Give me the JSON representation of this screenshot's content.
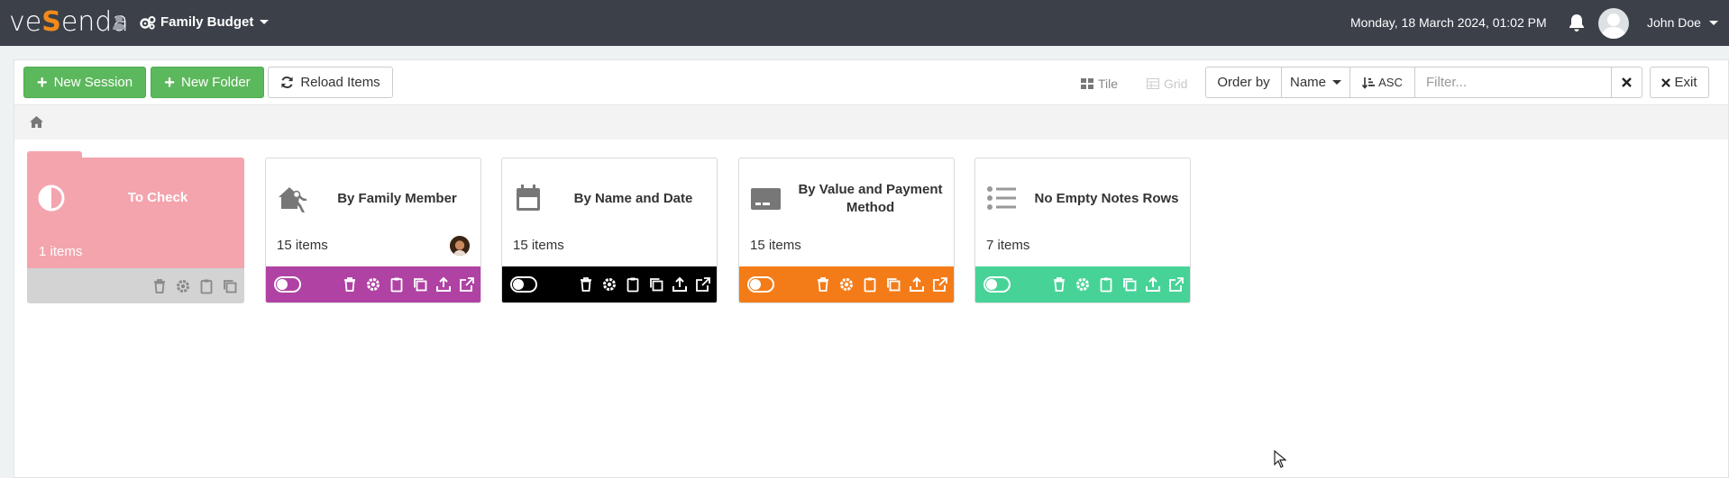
{
  "header": {
    "logo_text_a": "ve",
    "logo_text_s": "S",
    "logo_text_b": "enda",
    "workspace": "Family Budget",
    "datetime": "Monday, 18 March 2024, 01:02 PM",
    "user_name": "John Doe"
  },
  "toolbar": {
    "new_session": "New Session",
    "new_folder": "New Folder",
    "reload_items": "Reload Items",
    "tile": "Tile",
    "grid": "Grid",
    "order_by": "Order by",
    "order_field": "Name",
    "order_dir": "ASC",
    "filter_placeholder": "Filter...",
    "exit": "Exit"
  },
  "folder": {
    "title": "To Check",
    "count": "1 items",
    "color": "#f4a4ad",
    "footer_color": "#d3d3d3"
  },
  "cards": [
    {
      "title": "By Family Member",
      "count": "15 items",
      "footer_color": "#b042a4",
      "icon": "person-house-icon"
    },
    {
      "title": "By Name and Date",
      "count": "15 items",
      "footer_color": "#000000",
      "icon": "calendar-icon"
    },
    {
      "title": "By Value and Payment Method",
      "count": "15 items",
      "footer_color": "#f47c18",
      "icon": "credit-card-icon"
    },
    {
      "title": "No Empty Notes Rows",
      "count": "7 items",
      "footer_color": "#47d398",
      "icon": "list-icon"
    }
  ],
  "colors": {
    "topbar": "#3b4049",
    "accent": "#f28b1b",
    "green_button": "#5cb85c"
  }
}
